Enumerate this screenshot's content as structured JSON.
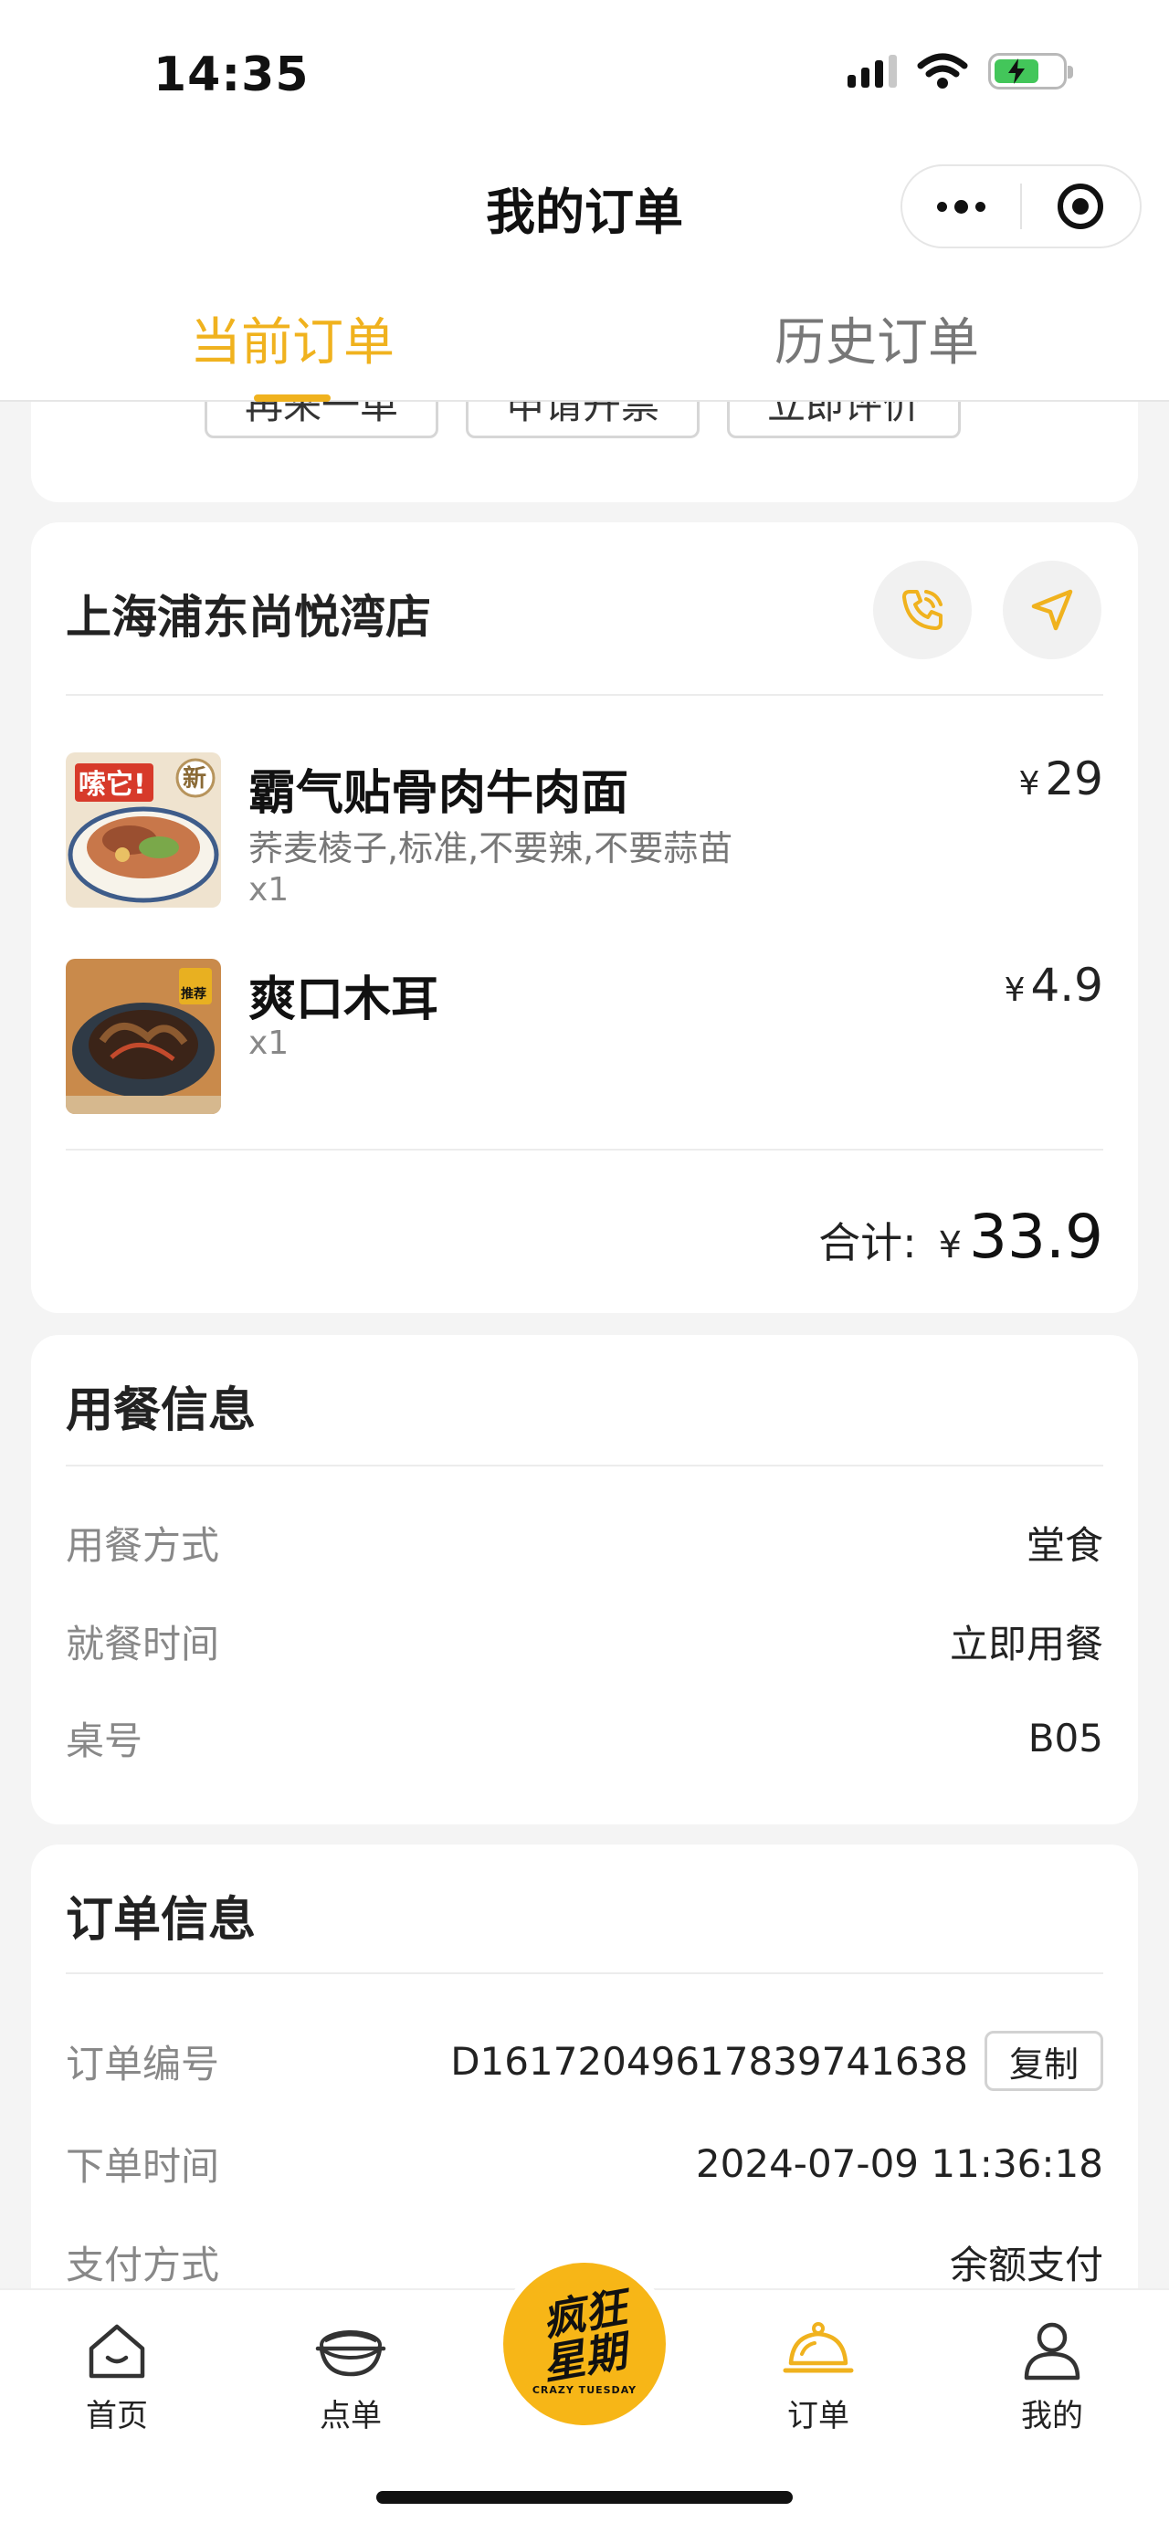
{
  "status_bar": {
    "time": "14:35"
  },
  "nav": {
    "title": "我的订单"
  },
  "tabs": [
    {
      "label": "当前订单",
      "active": true
    },
    {
      "label": "历史订单",
      "active": false
    }
  ],
  "order_actions": [
    "再来一单",
    "申请开票",
    "立即评价"
  ],
  "store": {
    "name": "上海浦东尚悦湾店"
  },
  "items": [
    {
      "name": "霸气贴骨肉牛肉面",
      "spec": "荞麦棱子,标准,不要辣,不要蒜苗",
      "qty": "x1",
      "currency": "¥",
      "price": "29",
      "image_badge": "嗦它!",
      "image_tag": "新"
    },
    {
      "name": "爽口木耳",
      "spec": "",
      "qty": "x1",
      "currency": "¥",
      "price": "4.9",
      "image_tag": "推荐"
    }
  ],
  "total": {
    "label": "合计:",
    "currency": "¥",
    "value": "33.9"
  },
  "dining_info": {
    "title": "用餐信息",
    "rows": [
      {
        "key": "用餐方式",
        "value": "堂食"
      },
      {
        "key": "就餐时间",
        "value": "立即用餐"
      },
      {
        "key": "桌号",
        "value": "B05"
      }
    ]
  },
  "order_info": {
    "title": "订单信息",
    "rows": [
      {
        "key": "订单编号",
        "value": "D16172049617839741638"
      },
      {
        "key": "下单时间",
        "value": "2024-07-09 11:36:18"
      },
      {
        "key": "支付方式",
        "value": "余额支付"
      }
    ],
    "copy_label": "复制"
  },
  "tabbar": [
    {
      "label": "首页",
      "icon": "home-icon"
    },
    {
      "label": "点单",
      "icon": "bowl-icon"
    },
    {
      "label": "订单",
      "icon": "order-icon",
      "active": true
    },
    {
      "label": "我的",
      "icon": "profile-icon"
    }
  ],
  "logo": {
    "line1": "疯狂",
    "line2": "星期",
    "sub": "CRAZY TUESDAY"
  },
  "colors": {
    "accent": "#f0b21e",
    "background": "#f4f4f4",
    "card": "#ffffff"
  }
}
